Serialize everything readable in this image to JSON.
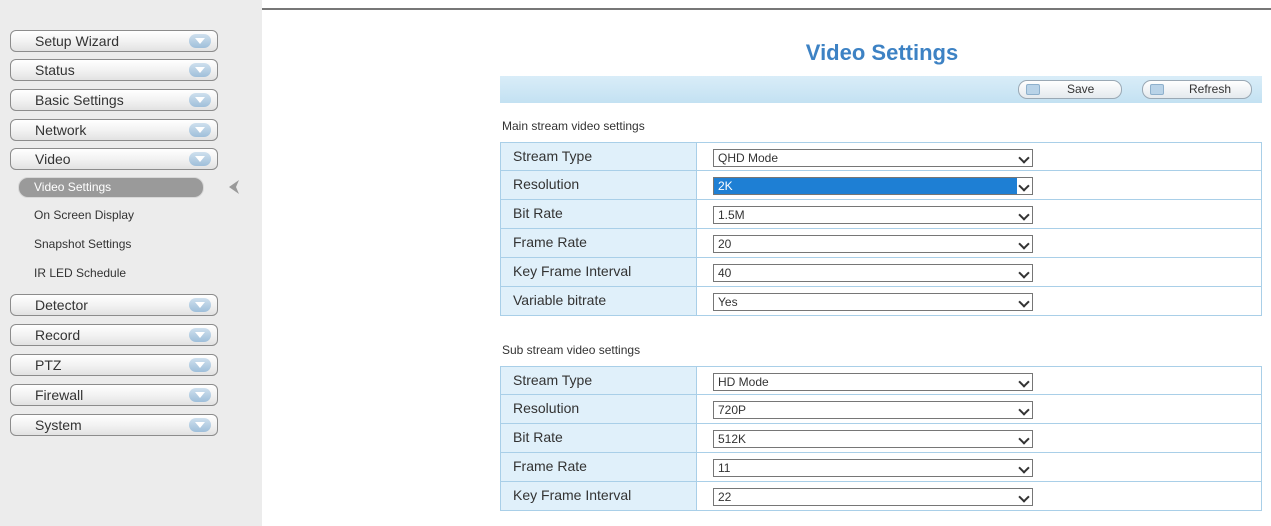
{
  "sidebar": {
    "items": [
      {
        "label": "Setup Wizard"
      },
      {
        "label": "Status"
      },
      {
        "label": "Basic Settings"
      },
      {
        "label": "Network"
      },
      {
        "label": "Video"
      },
      {
        "label": "Detector"
      },
      {
        "label": "Record"
      },
      {
        "label": "PTZ"
      },
      {
        "label": "Firewall"
      },
      {
        "label": "System"
      }
    ],
    "video_sub": [
      {
        "label": "Video Settings"
      },
      {
        "label": "On Screen Display"
      },
      {
        "label": "Snapshot Settings"
      },
      {
        "label": "IR LED Schedule"
      }
    ]
  },
  "page": {
    "title": "Video Settings",
    "save_label": "Save",
    "refresh_label": "Refresh"
  },
  "main_stream": {
    "heading": "Main stream video settings",
    "rows": [
      {
        "label": "Stream Type",
        "value": "QHD Mode"
      },
      {
        "label": "Resolution",
        "value": "2K"
      },
      {
        "label": "Bit Rate",
        "value": "1.5M"
      },
      {
        "label": "Frame Rate",
        "value": "20"
      },
      {
        "label": "Key Frame Interval",
        "value": "40"
      },
      {
        "label": "Variable bitrate",
        "value": "Yes"
      }
    ]
  },
  "sub_stream": {
    "heading": "Sub stream video settings",
    "rows": [
      {
        "label": "Stream Type",
        "value": "HD Mode"
      },
      {
        "label": "Resolution",
        "value": "720P"
      },
      {
        "label": "Bit Rate",
        "value": "512K"
      },
      {
        "label": "Frame Rate",
        "value": "11"
      },
      {
        "label": "Key Frame Interval",
        "value": "22"
      }
    ]
  },
  "colors": {
    "accent": "#3d82c4",
    "selected": "#1e7fd4"
  }
}
